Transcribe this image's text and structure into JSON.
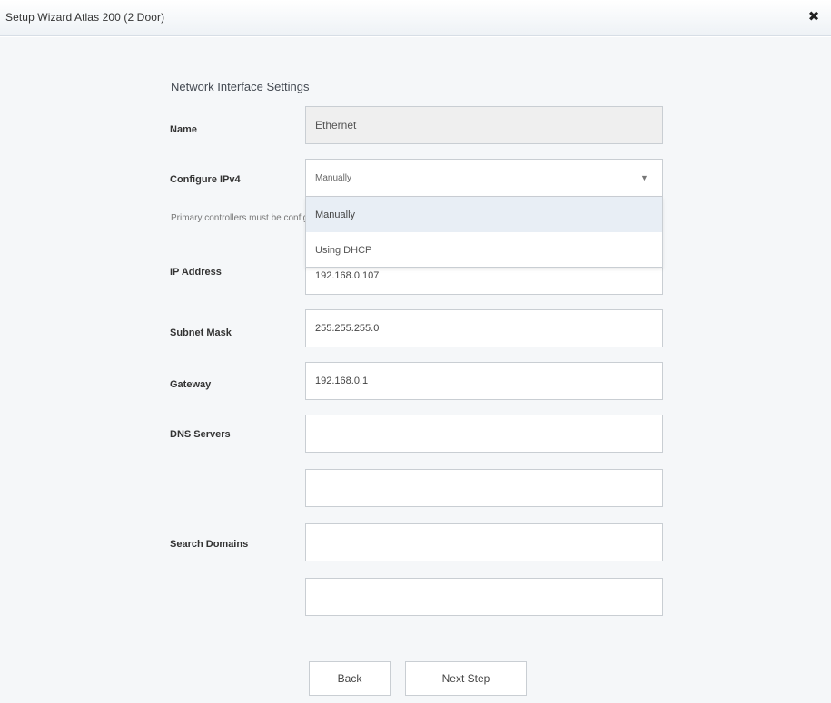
{
  "window": {
    "title": "Setup Wizard Atlas 200 (2 Door)",
    "close_glyph": "✖"
  },
  "section": {
    "title": "Network Interface Settings"
  },
  "fields": {
    "name": {
      "label": "Name",
      "value": "Ethernet"
    },
    "configure_ipv4": {
      "label": "Configure IPv4",
      "value": "Manually",
      "options": [
        "Manually",
        "Using DHCP"
      ]
    },
    "info_text": "Primary controllers must be configured manually; for secondary controllers, we recommend ...",
    "ip_address": {
      "label": "IP Address",
      "value": "192.168.0.107"
    },
    "subnet_mask": {
      "label": "Subnet Mask",
      "value": "255.255.255.0"
    },
    "gateway": {
      "label": "Gateway",
      "value": "192.168.0.1"
    },
    "dns_servers": {
      "label": "DNS Servers",
      "values": [
        "",
        ""
      ]
    },
    "search_domains": {
      "label": "Search Domains",
      "values": [
        "",
        ""
      ]
    }
  },
  "buttons": {
    "back": "Back",
    "next": "Next Step"
  },
  "icons": {
    "chevron": "chevron-down-icon",
    "close": "close-icon"
  }
}
